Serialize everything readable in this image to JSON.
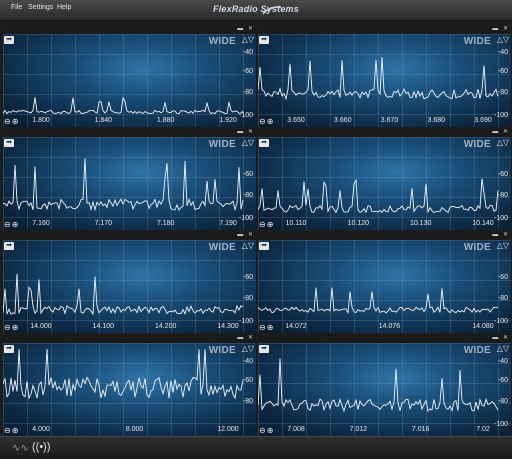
{
  "menu": [
    "File",
    "Settings",
    "Help"
  ],
  "brand": "FlexRadio Systems",
  "panel_label": "WIDE",
  "panel_controls": {
    "minimize": "▬",
    "close": "✕"
  },
  "panels": [
    {
      "id": "p1",
      "db": [
        "-40",
        "-60",
        "-80",
        "-100"
      ],
      "freqs": [
        "1.800",
        "1.840",
        "1.880",
        "1.920"
      ]
    },
    {
      "id": "p2",
      "db": [
        "-40",
        "-60",
        "-80",
        "-100"
      ],
      "freqs": [
        "3.650",
        "3.660",
        "3.670",
        "3.680",
        "3.690"
      ]
    },
    {
      "id": "p3",
      "db": [
        "-60",
        "-80",
        "-100"
      ],
      "freqs": [
        "7.160",
        "7.170",
        "7.180",
        "7.190"
      ]
    },
    {
      "id": "p4",
      "db": [
        "-60",
        "-80",
        "-100"
      ],
      "freqs": [
        "10.110",
        "10.120",
        "10.130",
        "10.140"
      ]
    },
    {
      "id": "p5",
      "db": [
        "-60",
        "-80",
        "-100"
      ],
      "freqs": [
        "14.000",
        "14.100",
        "14.200",
        "14.300"
      ]
    },
    {
      "id": "p6",
      "db": [
        "-60",
        "-80",
        "-100"
      ],
      "freqs": [
        "14.072",
        "14.076",
        "14.080"
      ]
    },
    {
      "id": "p7",
      "db": [
        "-40",
        "-60",
        "-80"
      ],
      "freqs": [
        "4.000",
        "8.000",
        "12.000"
      ]
    },
    {
      "id": "p8",
      "db": [
        "-40",
        "-60",
        "-80",
        "-100"
      ],
      "freqs": [
        "7.008",
        "7.012",
        "7.016",
        "7.02"
      ]
    }
  ],
  "accent": "#2f74a8"
}
